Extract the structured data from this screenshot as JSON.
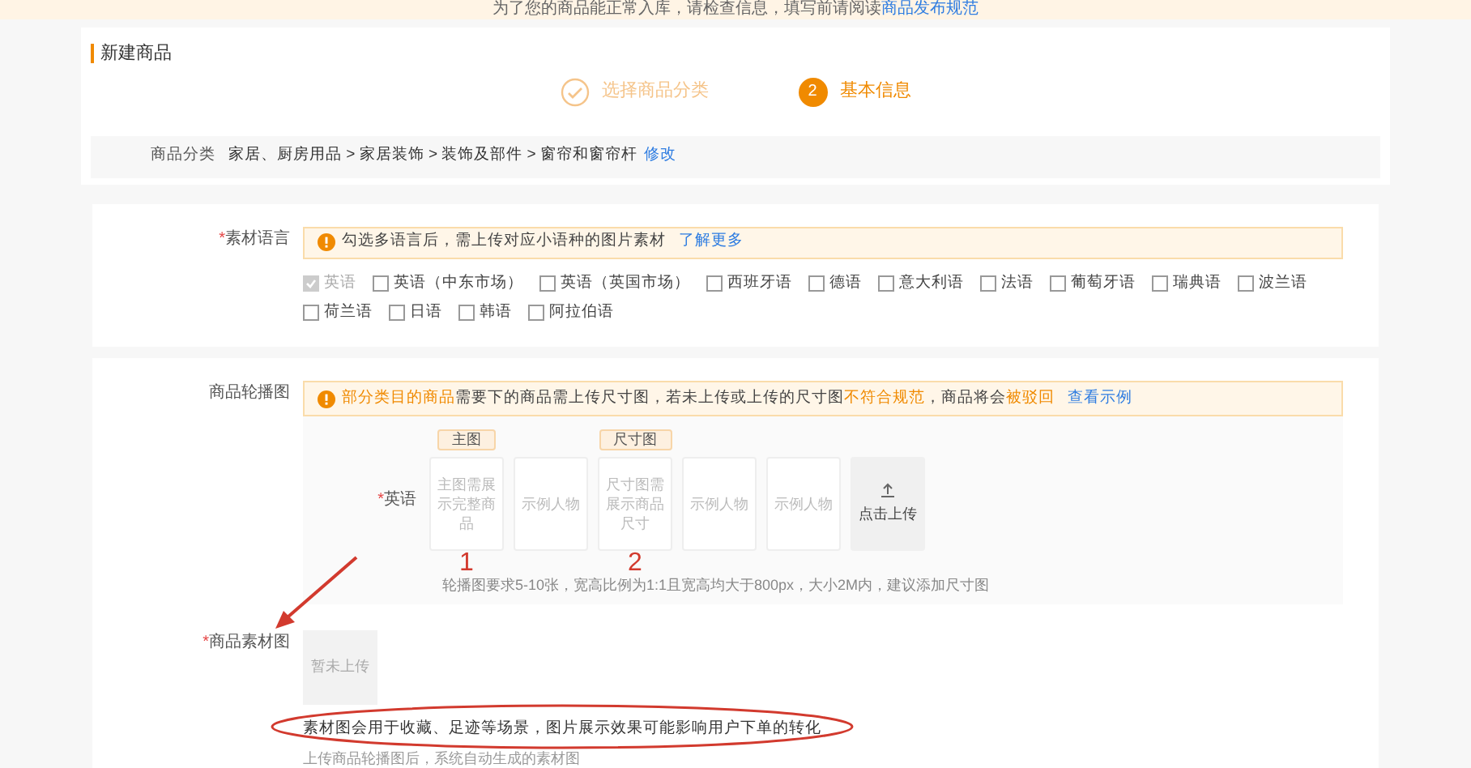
{
  "banner": {
    "text": "为了您的商品能正常入库，请检查信息，填写前请阅读",
    "link": "商品发布规范"
  },
  "page_title": "新建商品",
  "steps": [
    {
      "label": "选择商品分类",
      "done": true
    },
    {
      "number": "2",
      "label": "基本信息",
      "done": false
    }
  ],
  "category": {
    "label": "商品分类",
    "path": "家居、厨房用品 > 家居装饰 > 装饰及部件 > 窗帘和窗帘杆",
    "action": "修改"
  },
  "material_language": {
    "label": "素材语言",
    "required_mark": "*",
    "notice": {
      "text": "勾选多语言后，需上传对应小语种的图片素材",
      "link": "了解更多"
    },
    "languages": [
      {
        "label": "英语",
        "checked": true,
        "disabled": true
      },
      {
        "label": "英语（中东市场）",
        "checked": false,
        "disabled": false
      },
      {
        "label": "英语（英国市场）",
        "checked": false,
        "disabled": false
      },
      {
        "label": "西班牙语",
        "checked": false,
        "disabled": false
      },
      {
        "label": "德语",
        "checked": false,
        "disabled": false
      },
      {
        "label": "意大利语",
        "checked": false,
        "disabled": false
      },
      {
        "label": "法语",
        "checked": false,
        "disabled": false
      },
      {
        "label": "葡萄牙语",
        "checked": false,
        "disabled": false
      },
      {
        "label": "瑞典语",
        "checked": false,
        "disabled": false
      },
      {
        "label": "波兰语",
        "checked": false,
        "disabled": false
      },
      {
        "label": "荷兰语",
        "checked": false,
        "disabled": false
      },
      {
        "label": "日语",
        "checked": false,
        "disabled": false
      },
      {
        "label": "韩语",
        "checked": false,
        "disabled": false
      },
      {
        "label": "阿拉伯语",
        "checked": false,
        "disabled": false
      }
    ]
  },
  "carousel": {
    "label": "商品轮播图",
    "notice": {
      "parts": [
        {
          "text": "部分类目的商品",
          "highlight": true
        },
        {
          "text": "需要下的商品需上传尺寸图，若未上传或上传的尺寸图",
          "highlight": false
        },
        {
          "text": "不符合规范",
          "highlight": true
        },
        {
          "text": "，商品将会",
          "highlight": false
        },
        {
          "text": "被驳回",
          "highlight": true
        }
      ],
      "link": "查看示例"
    },
    "rows": [
      {
        "label": "英语",
        "required_mark": "*",
        "slots": [
          {
            "tag": "主图",
            "text": "主图需展示完整商品",
            "marker": "1"
          },
          {
            "text": "示例人物"
          },
          {
            "tag": "尺寸图",
            "text": "尺寸图需展示商品尺寸",
            "marker": "2"
          },
          {
            "text": "示例人物"
          },
          {
            "text": "示例人物"
          }
        ],
        "upload": "点击上传",
        "hint": "轮播图要求5-10张，宽高比例为1:1且宽高均大于800px，大小2M内，建议添加尺寸图"
      }
    ]
  },
  "material_image": {
    "label": "商品素材图",
    "required_mark": "*",
    "placeholder": "暂未上传",
    "note": "素材图会用于收藏、足迹等场景，图片展示效果可能影响用户下单的转化",
    "hint": "上传商品轮播图后，系统自动生成的素材图"
  }
}
